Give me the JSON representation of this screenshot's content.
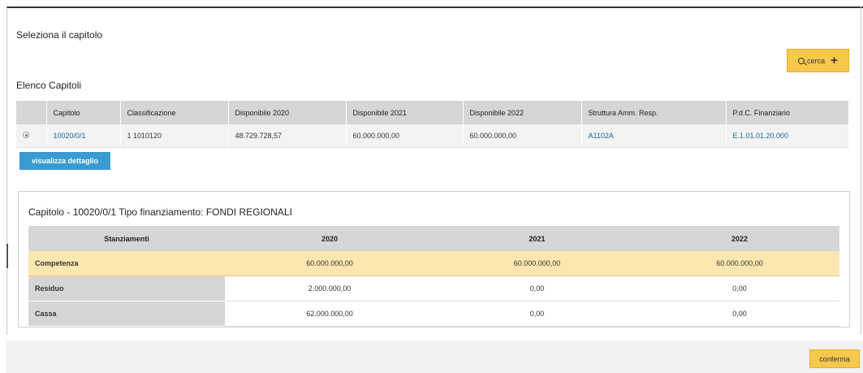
{
  "header": {
    "title": "Seleziona il capitolo"
  },
  "search": {
    "label": "cerca",
    "plus": "+"
  },
  "elenco": {
    "title": "Elenco Capitoli",
    "columns": [
      "",
      "Capitolo",
      "Classificazione",
      "Disponibile 2020",
      "Disponibile 2021",
      "Disponibile 2022",
      "Struttura Amm. Resp.",
      "P.d.C. Finanziario"
    ],
    "rows": [
      {
        "capitolo": "10020/0/1",
        "classificazione": "1 1010120",
        "disp2020": "48.729.728,57",
        "disp2021": "60.000.000,00",
        "disp2022": "60.000.000,00",
        "struttura": "A1102A",
        "pdc": "E.1.01.01.20.000"
      }
    ]
  },
  "dettaglio_button": "visualizza dettaglio",
  "panel": {
    "title": "Capitolo - 10020/0/1 Tipo finanziamento: FONDI REGIONALI",
    "columns": [
      "Stanziamenti",
      "2020",
      "2021",
      "2022"
    ],
    "rows": [
      {
        "label": "Competenza",
        "v2020": "60.000.000,00",
        "v2021": "60.000.000,00",
        "v2022": "60.000.000,00"
      },
      {
        "label": "Residuo",
        "v2020": "2.000.000,00",
        "v2021": "0,00",
        "v2022": "0,00"
      },
      {
        "label": "Cassa",
        "v2020": "62.000.000,00",
        "v2021": "0,00",
        "v2022": "0,00"
      }
    ]
  },
  "footer": {
    "confirm": "conferma"
  },
  "colors": {
    "accent": "#f6c84c",
    "primary_button": "#3a9bd1",
    "highlight_row": "#fde7b0",
    "link": "#1f5f9a"
  },
  "icons": {
    "search": "search-icon",
    "add": "plus-icon",
    "radio": "radio-icon"
  }
}
